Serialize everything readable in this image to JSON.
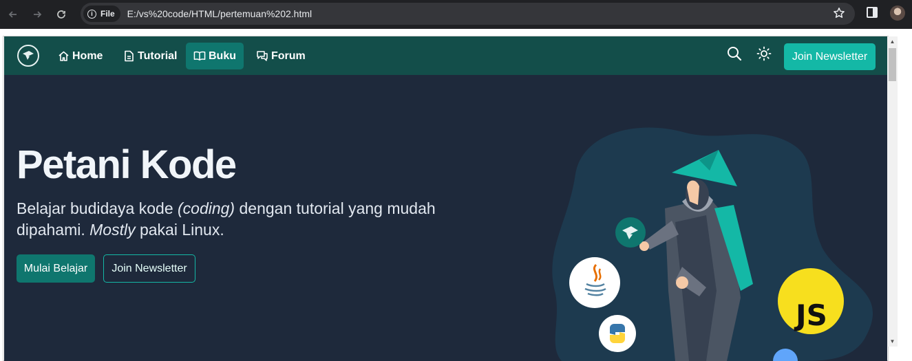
{
  "browser": {
    "nav_icons": [
      "back-arrow-icon",
      "forward-arrow-icon",
      "reload-icon"
    ],
    "site_chip_label": "File",
    "url": "E:/vs%20code/HTML/pertemuan%202.html",
    "toolbar_icons": [
      "bookmark-star-icon",
      "side-panel-icon",
      "profile-avatar"
    ]
  },
  "navbar": {
    "items": [
      {
        "label": "Home",
        "icon": "home-icon",
        "active": false
      },
      {
        "label": "Tutorial",
        "icon": "document-icon",
        "active": false
      },
      {
        "label": "Buku",
        "icon": "book-icon",
        "active": true
      },
      {
        "label": "Forum",
        "icon": "chat-icon",
        "active": false
      }
    ],
    "tools": [
      "search-icon",
      "theme-toggle-sun-icon"
    ],
    "cta_label": "Join Newsletter"
  },
  "hero": {
    "title": "Petani Kode",
    "lead_part1": "Belajar budidaya kode ",
    "lead_italic1": "(coding)",
    "lead_part2": " dengan tutorial yang mudah dipahami. ",
    "lead_italic2": "Mostly",
    "lead_part3": " pakai Linux.",
    "primary_button": "Mulai Belajar",
    "secondary_button": "Join Newsletter"
  },
  "illustration": {
    "badges": [
      "java-logo",
      "python-logo",
      "javascript-logo",
      "petanikode-logo"
    ],
    "js_label": "JS"
  },
  "colors": {
    "page_bg": "#1e293b",
    "navbar_bg": "#134e4a",
    "accent": "#14b8a6",
    "primary_button": "#0f766e",
    "js_yellow": "#f7df1e"
  }
}
